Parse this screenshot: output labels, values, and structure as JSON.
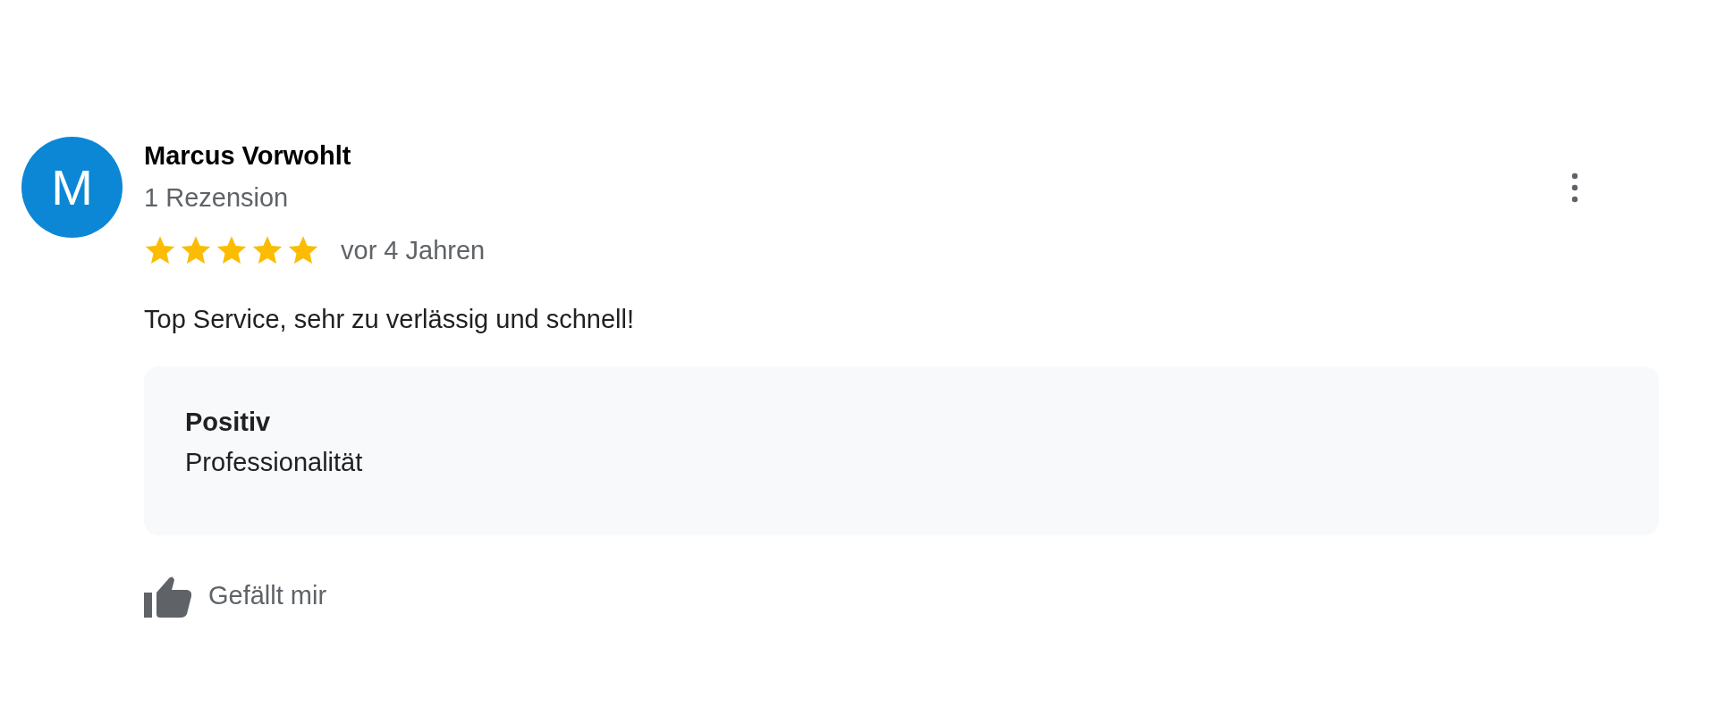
{
  "review": {
    "avatar_letter": "M",
    "author": "Marcus Vorwohlt",
    "author_meta": "1 Rezension",
    "stars": 5,
    "time": "vor 4 Jahren",
    "text": "Top Service, sehr zu verlässig und schnell!",
    "highlights": {
      "heading": "Positiv",
      "items": [
        "Professionalität"
      ]
    },
    "like_label": "Gefällt mir"
  }
}
